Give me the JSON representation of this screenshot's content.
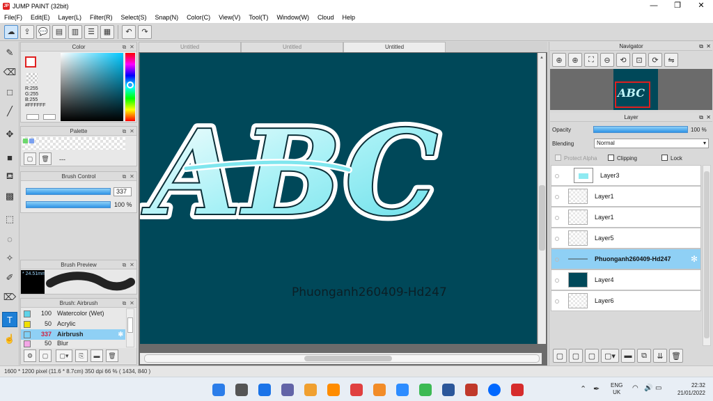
{
  "window": {
    "title": "JUMP PAINT (32bit)",
    "app_icon": "jump-paint-icon",
    "controls": [
      "—",
      "❐",
      "✕"
    ]
  },
  "menu": [
    "File(F)",
    "Edit(E)",
    "Layer(L)",
    "Filter(R)",
    "Select(S)",
    "Snap(N)",
    "Color(C)",
    "View(V)",
    "Tool(T)",
    "Window(W)",
    "Cloud",
    "Help"
  ],
  "color_panel": {
    "title": "Color",
    "r": "R:255",
    "g": "G:255",
    "b": "B:255",
    "hex": "#FFFFFF"
  },
  "palette_panel": {
    "title": "Palette",
    "label": "---"
  },
  "brush_control": {
    "title": "Brush Control",
    "size": "337",
    "opacity": "100 %"
  },
  "brush_preview": {
    "title": "Brush Preview",
    "size_label": "* 24.51mm"
  },
  "brush_list": {
    "title": "Brush: Airbrush",
    "items": [
      {
        "size": "100",
        "name": "Watercolor (Wet)",
        "color": "#5fd3e8"
      },
      {
        "size": "50",
        "name": "Acrylic",
        "color": "#f0e000"
      },
      {
        "size": "337",
        "name": "Airbrush",
        "color": "#7fd0f6"
      },
      {
        "size": "50",
        "name": "Blur",
        "color": "#f3a6e6"
      }
    ]
  },
  "doc_tabs": [
    "Untitled",
    "Untitled",
    "Untitled"
  ],
  "canvas": {
    "background": "#004859",
    "artwork_text": "ABC",
    "watermark": "Phuonganh260409-Hd247"
  },
  "navigator": {
    "title": "Navigator"
  },
  "layer_panel": {
    "title": "Layer",
    "opacity_label": "Opacity",
    "opacity_value": "100 %",
    "blending_label": "Blending",
    "blending_value": "Normal",
    "protect_alpha": "Protect Alpha",
    "clipping": "Clipping",
    "lock": "Lock",
    "layers": [
      {
        "name": "Layer3"
      },
      {
        "name": "Layer1"
      },
      {
        "name": "Layer1"
      },
      {
        "name": "Layer5"
      },
      {
        "name": "Phuonganh260409-Hd247"
      },
      {
        "name": "Layer4"
      },
      {
        "name": "Layer6"
      }
    ]
  },
  "status": {
    "text": "1600 * 1200 pixel   (11.6 * 8.7cm)   350 dpi   66 %   ( 1434, 840 )"
  },
  "taskbar": {
    "lang1": "ENG",
    "lang2": "UK",
    "time": "22:32",
    "date": "21/01/2022"
  }
}
